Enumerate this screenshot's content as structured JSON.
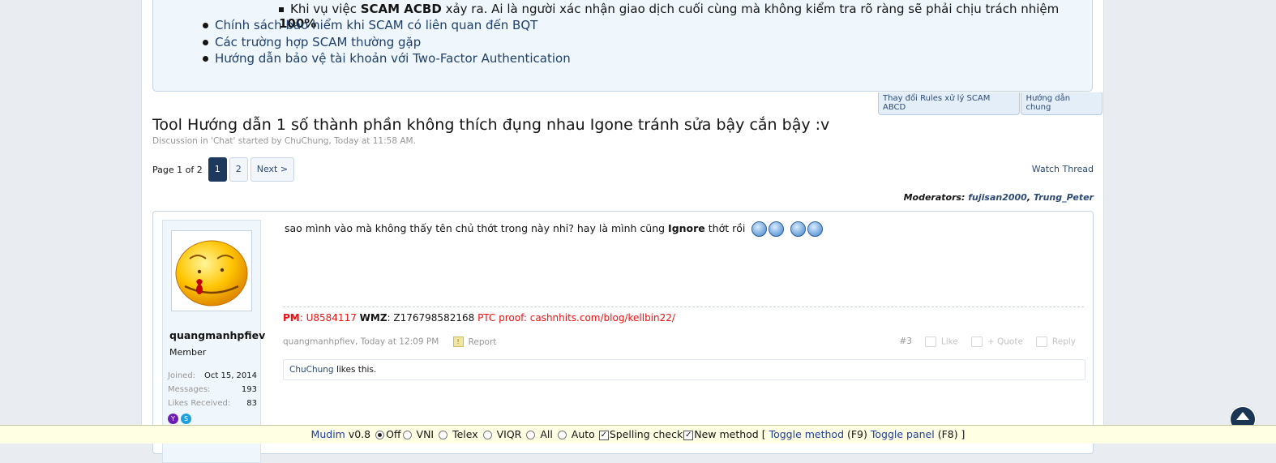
{
  "notice": {
    "sub_item_pre": "Khi vụ việc ",
    "sub_item_bold": "SCAM ACBD",
    "sub_item_mid": " xảy ra. Ai là người xác nhận giao dịch cuối cùng mà không kiểm tra rõ ràng sẽ phải chịu trách nhiệm ",
    "sub_item_bold2": "100%",
    "links": [
      "Chính sách bảo hiểm khi SCAM có liên quan đến BQT",
      "Các trường hợp SCAM thường gặp",
      "Hướng dẫn bảo vệ tài khoản với Two-Factor Authentication"
    ]
  },
  "notice_tabs": [
    "Thay đổi Rules xử lý SCAM ABCD",
    "Hướng dẫn chung"
  ],
  "thread": {
    "title": "Tool Hướng dẫn 1 số thành phần không thích đụng nhau Igone tránh sửa bậy cắn bậy :v",
    "meta": "Discussion in 'Chat' started by ChuChung, Today at 11:58 AM."
  },
  "pager": {
    "label": "Page 1 of 2",
    "pages": [
      "1",
      "2"
    ],
    "next": "Next >"
  },
  "watch_thread": "Watch Thread",
  "moderators": {
    "label": "Moderators: ",
    "names": [
      "fujisan2000",
      "Trung_Peter"
    ],
    "sep": ", "
  },
  "post": {
    "username": "quangmanhpfiev",
    "user_title": "Member",
    "stats": [
      {
        "k": "Joined:",
        "v": "Oct 15, 2014"
      },
      {
        "k": "Messages:",
        "v": "193"
      },
      {
        "k": "Likes Received:",
        "v": "83"
      }
    ],
    "message_pre": "sao mình vào mà không thấy tên chủ thớt trong này nhỉ? hay là mình cũng ",
    "message_bold": "Ignore",
    "message_post": " thớt rồi",
    "signature": {
      "pm_label": "PM",
      "pm_value": ": U8584117 ",
      "wmz_label": "WMZ",
      "wmz_value": ": Z176798582168 ",
      "ptc": "PTC proof: cashnhits.com/blog/kellbin22/"
    },
    "meta_author": "quangmanhpfiev, Today at 12:09 PM",
    "report": "Report",
    "post_number": "#3",
    "like": "Like",
    "quote": "+ Quote",
    "reply": "Reply",
    "likes_user": "ChuChung",
    "likes_text": " likes this."
  },
  "mudim": {
    "brand": "Mudim",
    "version": " v0.8 ",
    "options": [
      "Off",
      "VNI",
      "Telex",
      "VIQR",
      "All",
      "Auto"
    ],
    "spelling": "Spelling check",
    "new_method": "New method",
    "bracket_open": " [ ",
    "toggle_method": "Toggle method",
    "f9": " (F9) ",
    "toggle_panel": "Toggle panel",
    "f8": " (F8) ]"
  },
  "colors": {
    "link": "#2d4a73",
    "accent": "#1d3a5e",
    "signature_red": "#ee1111"
  }
}
